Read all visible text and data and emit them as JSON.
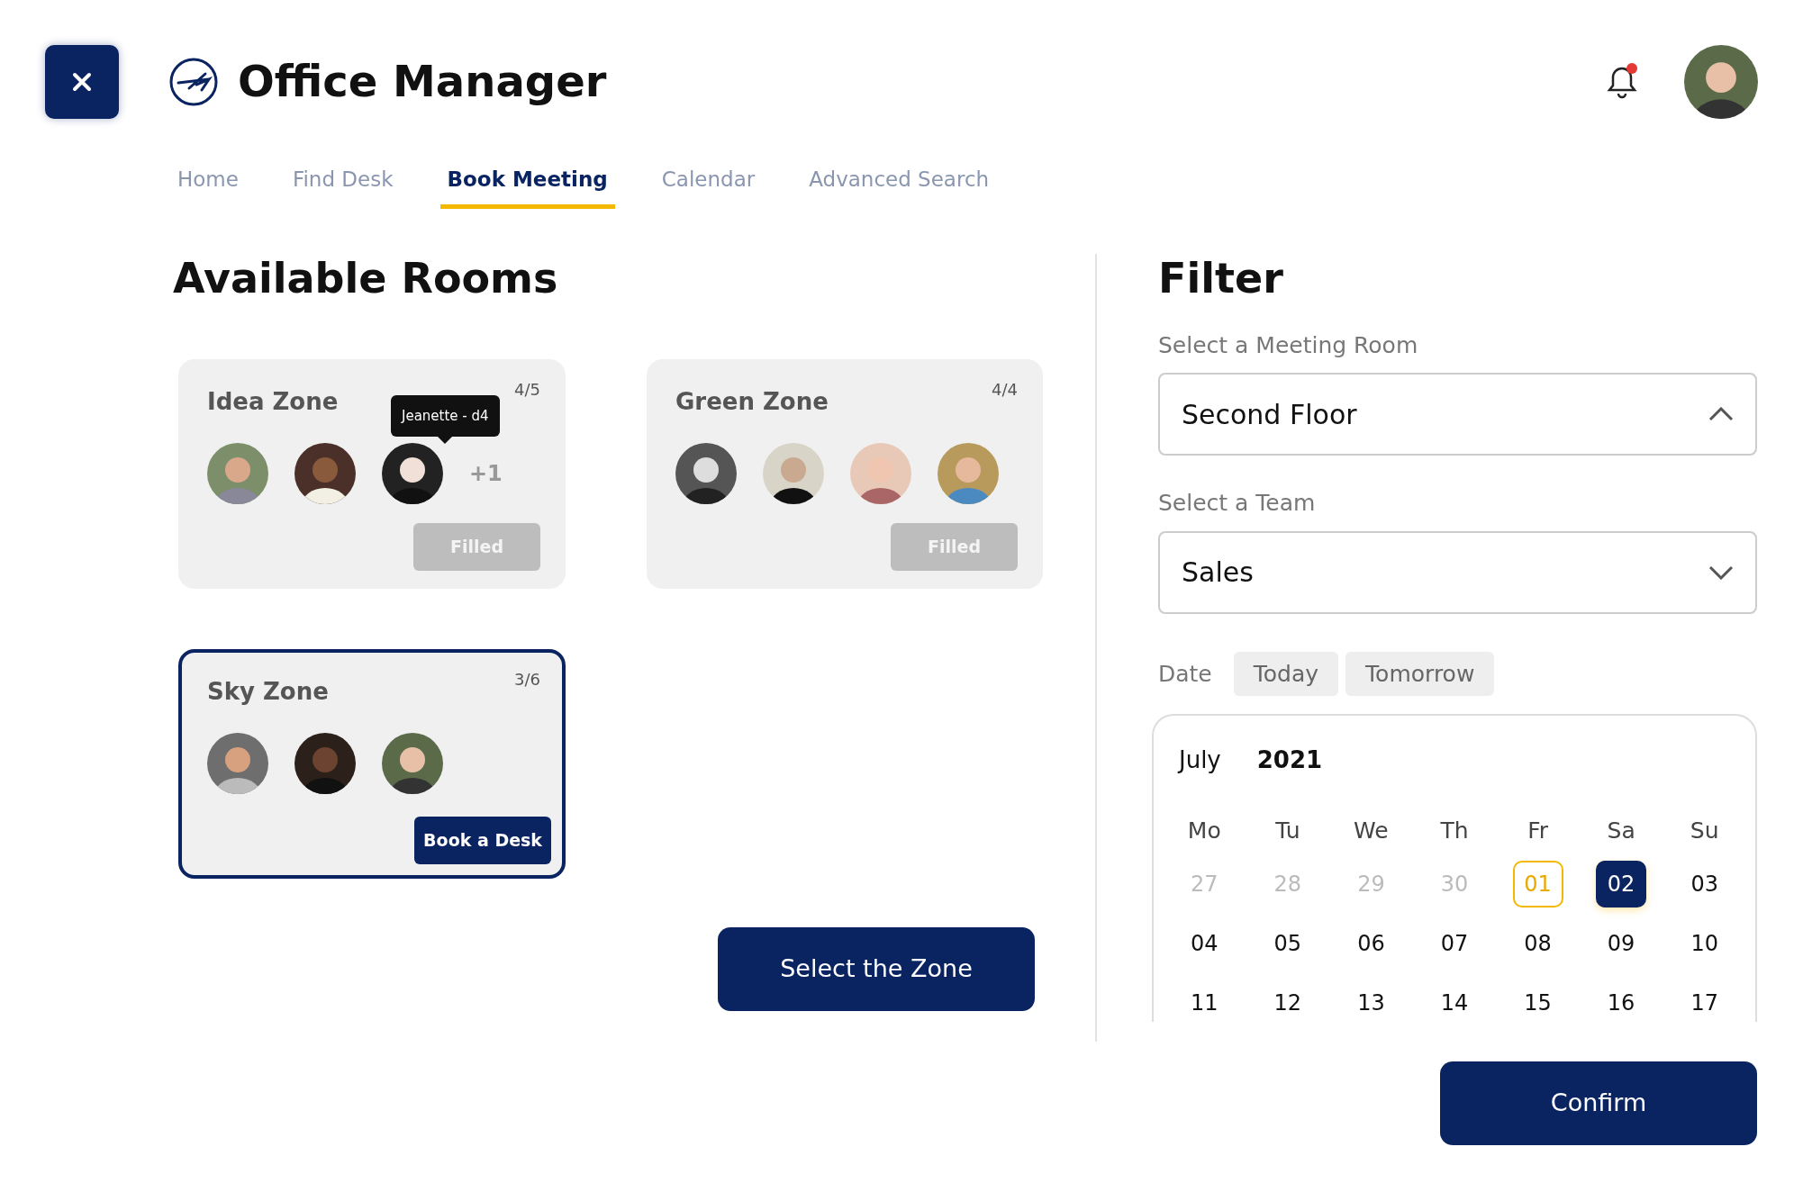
{
  "header": {
    "title": "Office Manager",
    "notification": true
  },
  "tabs": [
    {
      "label": "Home",
      "selected": false
    },
    {
      "label": "Find Desk",
      "selected": false
    },
    {
      "label": "Book Meeting",
      "selected": true
    },
    {
      "label": "Calendar",
      "selected": false
    },
    {
      "label": "Advanced Search",
      "selected": false
    }
  ],
  "rooms": {
    "title": "Available Rooms",
    "cards": [
      {
        "name": "Idea Zone",
        "count": "4/5",
        "selected": false,
        "more": "+1",
        "tooltip": "Jeanette - d4",
        "button": {
          "label": "Filled",
          "disabled": true
        }
      },
      {
        "name": "Green Zone",
        "count": "4/4",
        "selected": false,
        "button": {
          "label": "Filled",
          "disabled": true
        }
      },
      {
        "name": "Sky Zone",
        "count": "3/6",
        "selected": true,
        "button": {
          "label": "Book a Desk",
          "disabled": false
        }
      }
    ],
    "action": "Select the Zone"
  },
  "filter": {
    "title": "Filter",
    "selects": [
      {
        "label": "Select a Meeting Room",
        "value": "Second Floor",
        "expanded": true
      },
      {
        "label": "Select a Team",
        "value": "Sales",
        "expanded": false
      }
    ],
    "date_label": "Date",
    "date_chips": [
      {
        "label": "Today",
        "selected": false
      },
      {
        "label": "Tomorrow",
        "selected": false
      }
    ],
    "calendar": {
      "month": "July",
      "year": "2021",
      "weekdays": [
        "Mo",
        "Tu",
        "We",
        "Th",
        "Fr",
        "Sa",
        "Su"
      ],
      "days": [
        {
          "label": "27",
          "muted": true,
          "today": false,
          "selected": false
        },
        {
          "label": "28",
          "muted": true,
          "today": false,
          "selected": false
        },
        {
          "label": "29",
          "muted": true,
          "today": false,
          "selected": false
        },
        {
          "label": "30",
          "muted": true,
          "today": false,
          "selected": false
        },
        {
          "label": "01",
          "muted": false,
          "today": true,
          "selected": false
        },
        {
          "label": "02",
          "muted": false,
          "today": false,
          "selected": true
        },
        {
          "label": "03",
          "muted": false,
          "today": false,
          "selected": false
        },
        {
          "label": "04",
          "muted": false,
          "today": false,
          "selected": false
        },
        {
          "label": "05",
          "muted": false,
          "today": false,
          "selected": false
        },
        {
          "label": "06",
          "muted": false,
          "today": false,
          "selected": false
        },
        {
          "label": "07",
          "muted": false,
          "today": false,
          "selected": false
        },
        {
          "label": "08",
          "muted": false,
          "today": false,
          "selected": false
        },
        {
          "label": "09",
          "muted": false,
          "today": false,
          "selected": false
        },
        {
          "label": "10",
          "muted": false,
          "today": false,
          "selected": false
        },
        {
          "label": "11",
          "muted": false,
          "today": false,
          "selected": false
        },
        {
          "label": "12",
          "muted": false,
          "today": false,
          "selected": false
        },
        {
          "label": "13",
          "muted": false,
          "today": false,
          "selected": false
        },
        {
          "label": "14",
          "muted": false,
          "today": false,
          "selected": false
        },
        {
          "label": "15",
          "muted": false,
          "today": false,
          "selected": false
        },
        {
          "label": "16",
          "muted": false,
          "today": false,
          "selected": false
        },
        {
          "label": "17",
          "muted": false,
          "today": false,
          "selected": false
        }
      ]
    },
    "confirm": "Confirm"
  }
}
